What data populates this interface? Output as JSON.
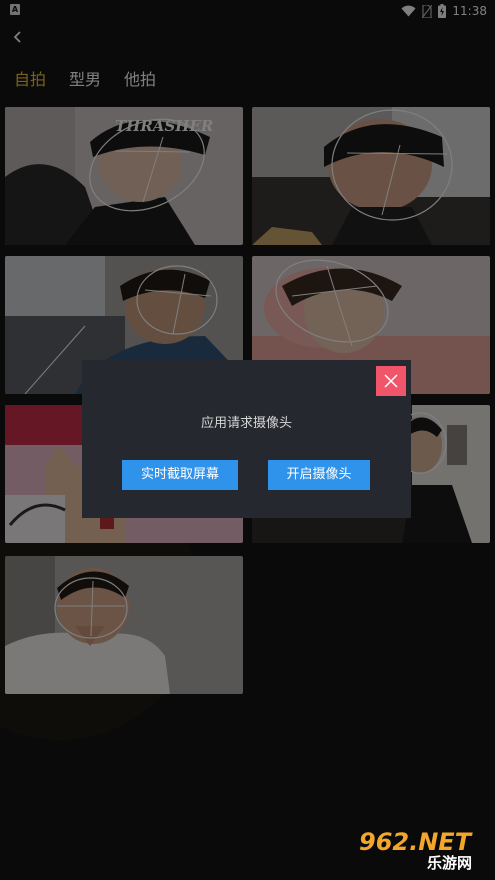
{
  "status_bar": {
    "app_badge": "A",
    "time": "11:38"
  },
  "nav": {
    "back_label": "<"
  },
  "tabs": [
    {
      "label": "自拍",
      "active": true
    },
    {
      "label": "型男",
      "active": false
    },
    {
      "label": "他拍",
      "active": false
    }
  ],
  "cards": [
    {
      "hat_text": "THRASHER"
    }
  ],
  "dialog": {
    "message": "应用请求摄像头",
    "left_button": "实时截取屏幕",
    "right_button": "开启摄像头"
  },
  "watermark": {
    "brand": "962.NET",
    "site": "乐游网"
  },
  "colors": {
    "background": "#141414",
    "active_tab": "#f4c232",
    "dialog_bg": "#262830",
    "button_blue": "#2f93ec",
    "close_red": "#f0556a"
  }
}
